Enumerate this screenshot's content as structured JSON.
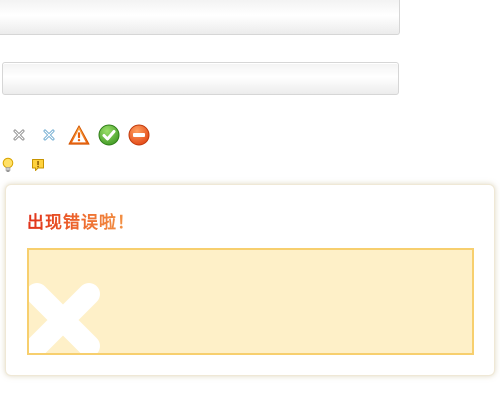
{
  "error_panel": {
    "title": "出现错误啦！",
    "message": ""
  },
  "icons": {
    "row1": [
      "close-x-icon",
      "close-x-blue-icon",
      "warning-triangle-icon",
      "success-check-icon",
      "stop-minus-icon"
    ],
    "row2": [
      "lightbulb-tip-icon",
      "alert-note-icon"
    ]
  },
  "colors": {
    "title_gradient_start": "#e0301a",
    "title_gradient_end": "#f39a4a",
    "message_bg": "#fef0c8",
    "message_border": "#f7cf6e",
    "warning_orange": "#f07a1a",
    "success_green": "#4aa82b",
    "stop_orange": "#e9501e"
  }
}
